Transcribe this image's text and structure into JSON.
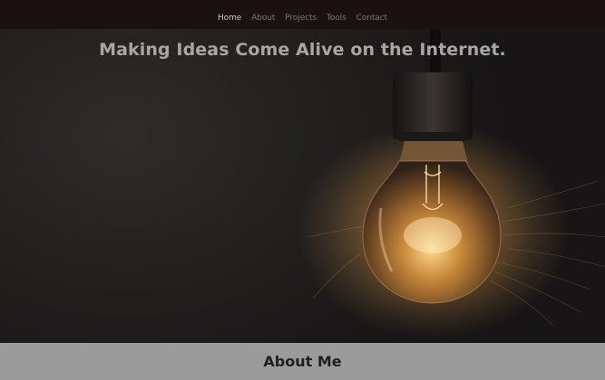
{
  "nav": {
    "items": [
      {
        "label": "Home",
        "active": true
      },
      {
        "label": "About",
        "active": false
      },
      {
        "label": "Projects",
        "active": false
      },
      {
        "label": "Tools",
        "active": false
      },
      {
        "label": "Contact",
        "active": false
      }
    ]
  },
  "hero": {
    "headline": "Making Ideas Come Alive on the Internet.",
    "image": "light-bulb-icon"
  },
  "about": {
    "title": "About Me"
  },
  "colors": {
    "navbar_bg": "#1a1110",
    "hero_bg": "#201e1d",
    "about_bg": "#9b9b9b",
    "bulb_glow": "#e8a24a"
  }
}
